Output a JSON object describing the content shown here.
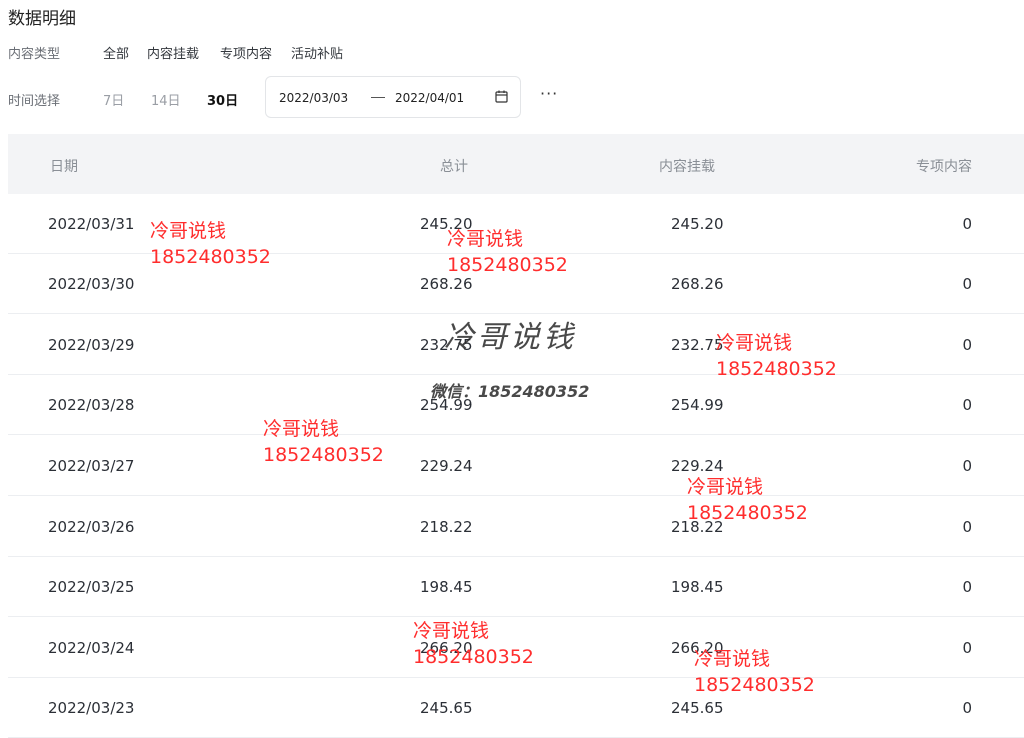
{
  "page": {
    "title": "数据明细"
  },
  "content_type": {
    "label": "内容类型",
    "options": [
      "全部",
      "内容挂载",
      "专项内容",
      "活动补贴"
    ]
  },
  "time_select": {
    "label": "时间选择",
    "options": [
      "7日",
      "14日",
      "30日"
    ],
    "active": "30日",
    "start_date": "2022/03/03",
    "end_date": "2022/04/01",
    "more_label": "···"
  },
  "table": {
    "headers": {
      "date": "日期",
      "total": "总计",
      "content": "内容挂载",
      "special": "专项内容"
    },
    "rows": [
      {
        "date": "2022/03/31",
        "total": "245.20",
        "content": "245.20",
        "special": "0"
      },
      {
        "date": "2022/03/30",
        "total": "268.26",
        "content": "268.26",
        "special": "0"
      },
      {
        "date": "2022/03/29",
        "total": "232.75",
        "content": "232.75",
        "special": "0"
      },
      {
        "date": "2022/03/28",
        "total": "254.99",
        "content": "254.99",
        "special": "0"
      },
      {
        "date": "2022/03/27",
        "total": "229.24",
        "content": "229.24",
        "special": "0"
      },
      {
        "date": "2022/03/26",
        "total": "218.22",
        "content": "218.22",
        "special": "0"
      },
      {
        "date": "2022/03/25",
        "total": "198.45",
        "content": "198.45",
        "special": "0"
      },
      {
        "date": "2022/03/24",
        "total": "266.20",
        "content": "266.20",
        "special": "0"
      },
      {
        "date": "2022/03/23",
        "total": "245.65",
        "content": "245.65",
        "special": "0"
      }
    ]
  },
  "watermark": {
    "name": "冷哥说钱",
    "phone": "1852480352",
    "big_name": "冷哥说钱",
    "wechat": "微信：1852480352",
    "color": "#ff2d2d"
  }
}
